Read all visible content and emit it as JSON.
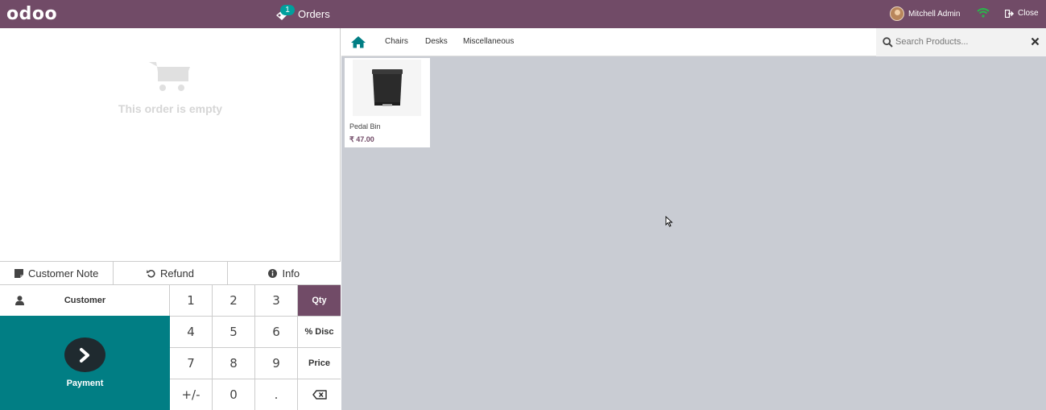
{
  "topbar": {
    "logo": "odoo",
    "orders_label": "Orders",
    "orders_count": "1",
    "user_name": "Mitchell Admin",
    "close_label": "Close"
  },
  "order": {
    "empty_text": "This order is empty"
  },
  "controls": {
    "customer_note": "Customer Note",
    "refund": "Refund",
    "info": "Info"
  },
  "numpad": {
    "customer": "Customer",
    "payment": "Payment",
    "keys": [
      "1",
      "2",
      "3",
      "Qty",
      "4",
      "5",
      "6",
      "% Disc",
      "7",
      "8",
      "9",
      "Price",
      "+/-",
      "0",
      "."
    ],
    "active_mode": "Qty"
  },
  "categories": [
    "Chairs",
    "Desks",
    "Miscellaneous"
  ],
  "search": {
    "placeholder": "Search Products..."
  },
  "products": [
    {
      "name": "Pedal Bin",
      "price": "₹ 47.00"
    }
  ],
  "colors": {
    "brand": "#714b67",
    "teal": "#017e84",
    "badge": "#00a09d",
    "product_area": "#c9ccd3"
  }
}
